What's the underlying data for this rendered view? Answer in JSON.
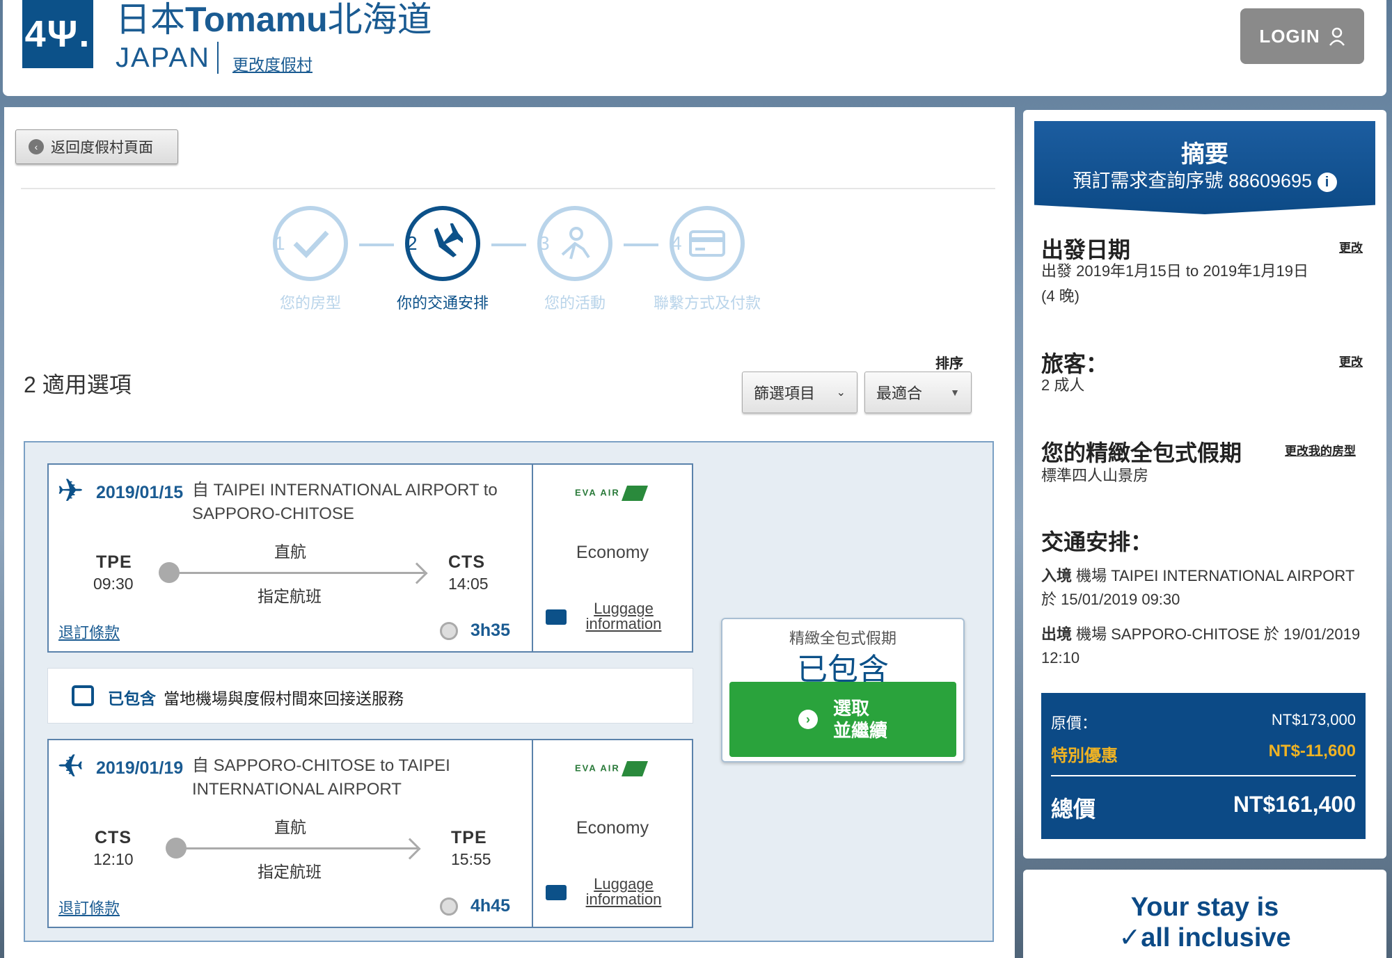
{
  "header": {
    "logo_text": "4Ψ.",
    "title_prefix": "日本",
    "title_brand": "Tomamu",
    "title_suffix": "北海道",
    "country": "JAPAN",
    "change_resort": "更改度假村",
    "login_label": "LOGIN"
  },
  "nav": {
    "back_label": "返回度假村頁面"
  },
  "steps": [
    {
      "num": "1",
      "label": "您的房型",
      "state": "done"
    },
    {
      "num": "2",
      "label": "你的交通安排",
      "state": "active"
    },
    {
      "num": "3",
      "label": "您的活動",
      "state": "upcoming"
    },
    {
      "num": "4",
      "label": "聯繫方式及付款",
      "state": "upcoming"
    }
  ],
  "results": {
    "count_text": "2 適用選項",
    "sort_heading": "排序",
    "filter_label": "篩選項目",
    "sort_value": "最適合"
  },
  "flights": [
    {
      "date": "2019/01/15",
      "route": "自 TAIPEI INTERNATIONAL AIRPORT to SAPPORO-CHITOSE",
      "from_code": "TPE",
      "from_time": "09:30",
      "to_code": "CTS",
      "to_time": "14:05",
      "type": "直航",
      "fare_type": "指定航班",
      "refund_label": "退訂條款",
      "duration": "3h35",
      "airline": "EVA AIR",
      "cabin": "Economy",
      "luggage_label": "Luggage information"
    },
    {
      "date": "2019/01/19",
      "route": "自 SAPPORO-CHITOSE to TAIPEI INTERNATIONAL AIRPORT",
      "from_code": "CTS",
      "from_time": "12:10",
      "to_code": "TPE",
      "to_time": "15:55",
      "type": "直航",
      "fare_type": "指定航班",
      "refund_label": "退訂條款",
      "duration": "4h45",
      "airline": "EVA AIR",
      "cabin": "Economy",
      "luggage_label": "Luggage information"
    }
  ],
  "transfer": {
    "included": "已包含",
    "text": "當地機場與度假村間來回接送服務"
  },
  "package": {
    "label": "精緻全包式假期",
    "status": "已包含",
    "select_line1": "選取",
    "select_line2": "並繼續"
  },
  "summary": {
    "title": "摘要",
    "ref_label": "預訂需求查詢序號 88609695",
    "dates_heading": "出發日期",
    "dates_change": "更改",
    "dates_text": "出發 2019年1月15日 to 2019年1月19日",
    "nights": "(4 晚)",
    "travellers_heading": "旅客：",
    "travellers_change": "更改",
    "travellers_text": "2 成人",
    "holiday_heading": "您的精緻全包式假期",
    "holiday_change": "更改我的房型",
    "holiday_text": "標準四人山景房",
    "transport_heading": "交通安排：",
    "outbound_label": "入境",
    "outbound_text": "機場 TAIPEI INTERNATIONAL AIRPORT",
    "outbound_time": "於 15/01/2019 09:30",
    "return_label": "出境",
    "return_text": "機場 SAPPORO-CHITOSE 於 19/01/2019",
    "return_time": "12:10"
  },
  "price": {
    "original_label": "原價：",
    "original_value": "NT$173,000",
    "discount_label": "特別優惠",
    "discount_value": "NT$-11,600",
    "total_label": "總價",
    "total_value": "NT$161,400"
  },
  "promo": {
    "line1": "Your stay is",
    "line2": "✓all inclusive"
  },
  "colors": {
    "brand": "#0c5189",
    "discount": "#f0b323",
    "select": "#2aa33c"
  }
}
